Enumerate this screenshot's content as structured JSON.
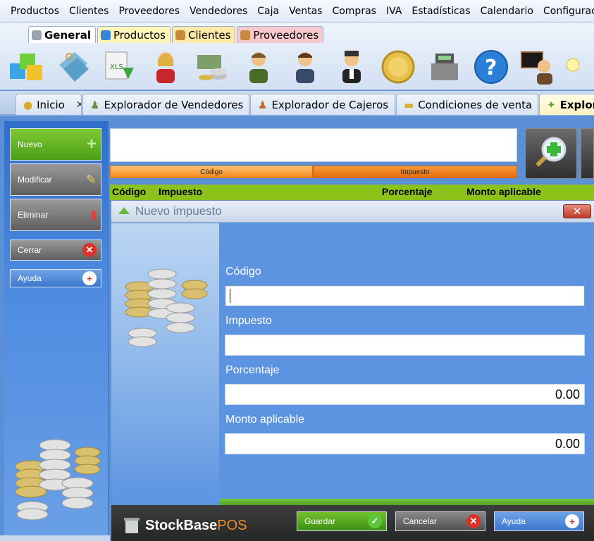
{
  "menu": [
    "Productos",
    "Clientes",
    "Proveedores",
    "Vendedores",
    "Caja",
    "Ventas",
    "Compras",
    "IVA",
    "Estadísticas",
    "Calendario",
    "Configuración"
  ],
  "ribbon": {
    "tabs": [
      "General",
      "Productos",
      "Clientes",
      "Proveedores"
    ],
    "active_tab": "General",
    "icons": [
      "boxes-icon",
      "tags-icon",
      "excel-export-icon",
      "woman-user-icon",
      "money-stack-icon",
      "man-user-icon",
      "cashier-icon",
      "waiter-icon",
      "gold-coin-icon",
      "cash-register-icon",
      "help-icon",
      "teacher-icon",
      "lightbulb-icon"
    ]
  },
  "doc_tabs": [
    {
      "label": "Inicio"
    },
    {
      "label": "Explorador de Vendedores"
    },
    {
      "label": "Explorador de Cajeros"
    },
    {
      "label": "Condiciones de venta"
    },
    {
      "label": "Explor"
    }
  ],
  "left_buttons": {
    "nuevo": "Nuevo",
    "modificar": "Modificar",
    "eliminar": "Eliminar",
    "cerrar": "Cerrar",
    "ayuda": "Ayuda"
  },
  "explorer": {
    "search_value": "",
    "sort_columns": [
      "Código",
      "Impuesto"
    ],
    "grid_columns": [
      "Código",
      "Impuesto",
      "Porcentaje",
      "Monto aplicable"
    ]
  },
  "dialog": {
    "title": "Nuevo impuesto",
    "fields": {
      "codigo": {
        "label": "Código",
        "value": ""
      },
      "impuesto": {
        "label": "Impuesto",
        "value": ""
      },
      "porcentaje": {
        "label": "Porcentaje",
        "value": "0.00"
      },
      "monto": {
        "label": "Monto aplicable",
        "value": "0.00"
      }
    },
    "brand": {
      "name": "StockBase",
      "suffix": "POS"
    },
    "buttons": {
      "guardar": "Guardar",
      "cancelar": "Cancelar",
      "ayuda": "Ayuda"
    }
  },
  "colors": {
    "accent_green": "#7ecb34",
    "accent_orange": "#f38a1e",
    "panel_blue": "#5c94e2",
    "grid_header": "#8cc21c"
  }
}
